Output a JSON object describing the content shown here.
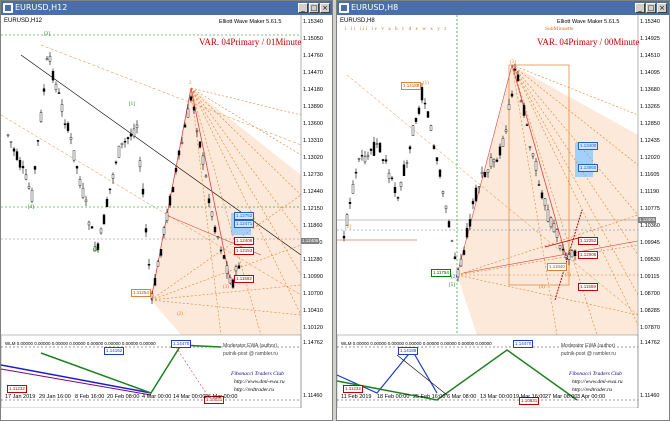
{
  "windows": [
    {
      "title": "EURUSD,H12",
      "symbol_label": "EURUSD,H12",
      "indicator": "Elliott Wave Maker 5.61.5",
      "variant": "VAR. 04Primary / 01Minute",
      "price_axis": [
        "1.15340",
        "1.15050",
        "1.14760",
        "1.14470",
        "1.14180",
        "1.13890",
        "1.13600",
        "1.13310",
        "1.13020",
        "1.12730",
        "1.12440",
        "1.12150",
        "1.11860",
        "1.11570",
        "1.11280",
        "1.10990",
        "1.10700",
        "1.10410",
        "1.10120"
      ],
      "price_tag": "1.12406",
      "sub_axis": [
        "1.14762",
        "1.11460"
      ],
      "dates": [
        "17 Jan 2019",
        "29 Jan 16:00",
        "8 Feb 16:00",
        "20 Feb 08:00",
        "4 Mar 00:00",
        "14 Mar 00:00",
        "26 Mar 00:00"
      ],
      "sub_label": "WLM 0.00000 0.00000 0.00000 0.00000 0.00000 0.00000 0.00000 0.00000",
      "wave_labels": [
        "[3]",
        "[4]",
        "(5)",
        "[1]",
        "2",
        "1",
        "(2)",
        "(3)"
      ],
      "price_boxes": [
        {
          "text": "1.12752",
          "kind": "blue"
        },
        {
          "text": "1.12471",
          "kind": "blue"
        },
        {
          "text": "1.12408",
          "kind": "red"
        },
        {
          "text": "1.12153",
          "kind": "red"
        },
        {
          "text": "1.11592",
          "kind": "red"
        },
        {
          "text": "1.11254",
          "kind": "orange"
        }
      ],
      "sub_boxes": [
        {
          "text": "1.14162"
        },
        {
          "text": "1.14470"
        },
        {
          "text": "1.11232"
        },
        {
          "text": "1.10031"
        }
      ],
      "watermark": [
        "Moderator EWA (author)",
        "putnik-post @ rambler.ru"
      ],
      "fib_club": [
        "Fibonacci Traders Club",
        "http://www.dmi-ewa.ru",
        "http://redtrader.ru"
      ]
    },
    {
      "title": "EURUSD,H8",
      "symbol_label": "EURUSD,H8",
      "indicator": "Elliott Wave Maker 5.61.5",
      "variant": "VAR. 04Primary / 00Minute",
      "top_letters": "i ii iii iv v a b c d e w x y z",
      "submin": "SubMinuette",
      "price_axis": [
        "1.15340",
        "1.14925",
        "1.14510",
        "1.14095",
        "1.13680",
        "1.13265",
        "1.12850",
        "1.12435",
        "1.12020",
        "1.11605",
        "1.11190",
        "1.10775",
        "1.10360",
        "1.09945",
        "1.09530",
        "1.09115",
        "1.08700",
        "1.08285",
        "1.07870"
      ],
      "price_tag": "1.12406",
      "sub_axis": [
        "1.14762",
        "1.11460"
      ],
      "dates": [
        "11 Feb 2019",
        "18 Feb 00:00",
        "25 Feb 16:00",
        "6 Mar 08:00",
        "13 Mar 00:00",
        "19 Mar 16:00",
        "27 Mar 08:00",
        "3 Apr 00:00"
      ],
      "sub_label": "WLM 0.00000 0.00000 0.00000 0.00000 0.00000 0.00000 0.00000 0.00000",
      "wave_labels": [
        "[2]",
        "(1)",
        "[5]",
        "(3)",
        "(4)",
        "(5)",
        "(2)"
      ],
      "price_boxes": [
        {
          "text": "1.14188",
          "kind": "orange"
        },
        {
          "text": "1.13400",
          "kind": "blue"
        },
        {
          "text": "1.13060",
          "kind": "blue"
        },
        {
          "text": "1.12252",
          "kind": "red"
        },
        {
          "text": "1.12006",
          "kind": "red"
        },
        {
          "text": "1.11840",
          "kind": "orange"
        },
        {
          "text": "1.11754",
          "kind": "green"
        },
        {
          "text": "1.11559",
          "kind": "red"
        }
      ],
      "sub_boxes": [
        {
          "text": "1.14188"
        },
        {
          "text": "1.14470"
        },
        {
          "text": "1.11232"
        },
        {
          "text": "1.10831"
        }
      ],
      "watermark": [
        "Moderator EWA (author)",
        "putnik-post @ rambler.ru"
      ],
      "fib_club": [
        "Fibonacci Traders Club",
        "http://www.dmi-ewa.ru",
        "http://redtrader.ru"
      ]
    }
  ]
}
